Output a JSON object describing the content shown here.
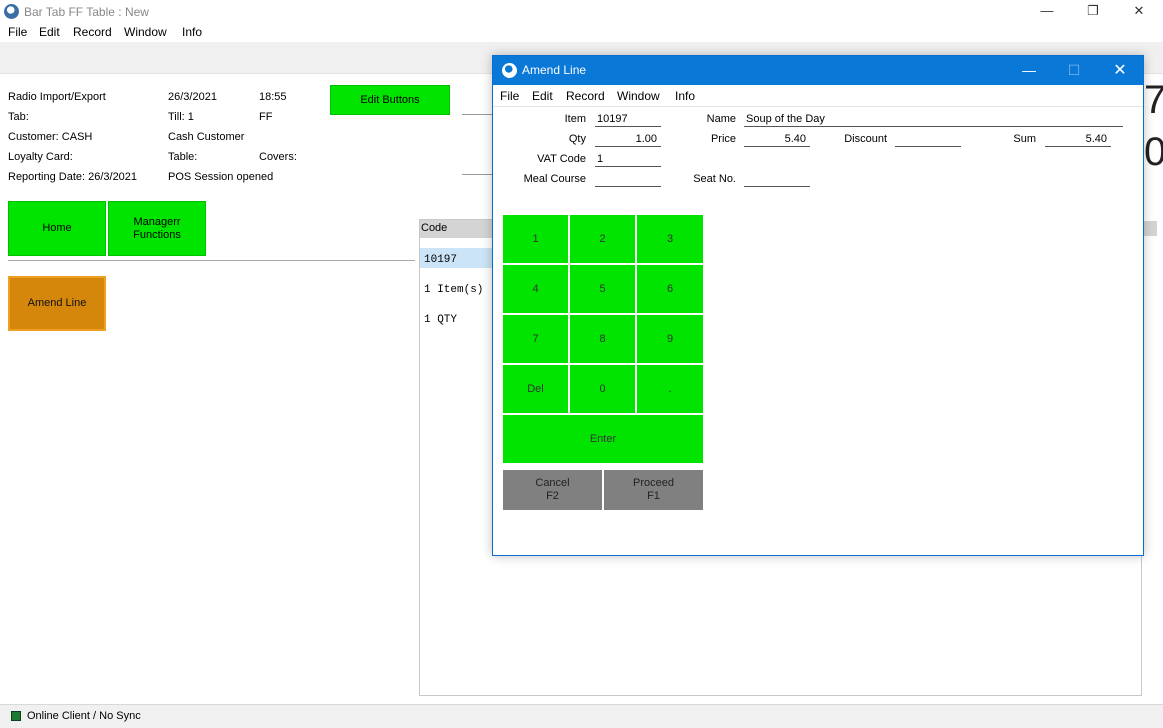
{
  "window": {
    "title": "Bar Tab FF Table : New",
    "minimize": "—",
    "restore": "❐",
    "close": "✕"
  },
  "menu": [
    "File",
    "Edit",
    "Record",
    "Window",
    "Info"
  ],
  "info": {
    "radio_import_export": "Radio Import/Export",
    "date": "26/3/2021",
    "time": "18:55",
    "tab": "Tab:",
    "till": "Till: 1",
    "till_code": "FF",
    "customer": "Customer: CASH",
    "customer_name": "Cash Customer",
    "loyalty_card": "Loyalty Card:",
    "table": "Table:",
    "covers": "Covers:",
    "reporting_date": "Reporting Date: 26/3/2021",
    "pos_session": "POS Session opened"
  },
  "buttons": {
    "edit_buttons": "Edit Buttons",
    "home": "Home",
    "manager_functions": "Managerr\nFunctions",
    "amend_line": "Amend Line"
  },
  "list": {
    "header": "Code",
    "rows": [
      "10197",
      "1 Item(s)",
      "1 QTY"
    ]
  },
  "status": {
    "text": "Online Client / No Sync"
  },
  "dialog": {
    "title": "Amend Line",
    "menu": [
      "File",
      "Edit",
      "Record",
      "Window",
      "Info"
    ],
    "fields": {
      "item_label": "Item",
      "item_value": "10197",
      "name_label": "Name",
      "name_value": "Soup of the Day",
      "qty_label": "Qty",
      "qty_value": "1.00",
      "price_label": "Price",
      "price_value": "5.40",
      "discount_label": "Discount",
      "discount_value": "",
      "sum_label": "Sum",
      "sum_value": "5.40",
      "vat_label": "VAT Code",
      "vat_value": "1",
      "meal_label": "Meal Course",
      "meal_value": "",
      "seat_label": "Seat No.",
      "seat_value": ""
    },
    "keypad": [
      "1",
      "2",
      "3",
      "4",
      "5",
      "6",
      "7",
      "8",
      "9",
      "Del",
      "0",
      ".",
      "Enter"
    ],
    "cancel": "Cancel\nF2",
    "proceed": "Proceed\nF1"
  },
  "colors": {
    "accent": "#0a78d7",
    "button_green": "#00e400",
    "amend_orange": "#d4870a",
    "action_grey": "#808080"
  }
}
